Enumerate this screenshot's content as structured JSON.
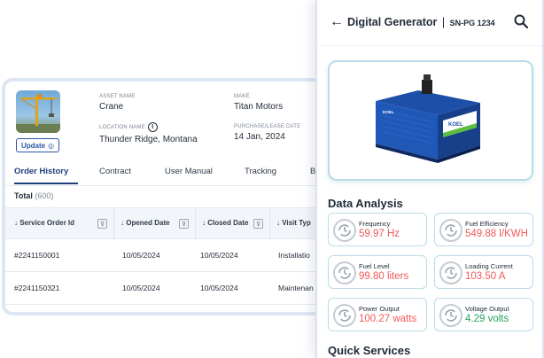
{
  "asset": {
    "name_label": "ASSET NAME",
    "name": "Crane",
    "make_label": "MAKE",
    "make": "Titan Motors",
    "location_label": "LOCATION NAME",
    "location": "Thunder Ridge, Montana",
    "purchase_label": "PURCHASE/LEASE DATE",
    "purchase_date": "14 Jan, 2024",
    "update_label": "Update"
  },
  "tabs": [
    "Order History",
    "Contract",
    "User Manual",
    "Tracking",
    "B"
  ],
  "total": {
    "label": "Total",
    "count": "(600)"
  },
  "table": {
    "columns": [
      "↓ Service Order Id",
      "↓ Opened Date",
      "↓ Closed Date",
      "↓ Visit Typ"
    ],
    "rows": [
      [
        "#2241150001",
        "10/05/2024",
        "10/05/2024",
        "Installatio"
      ],
      [
        "#2241150321",
        "10/05/2024",
        "10/05/2024",
        "Maintenan"
      ]
    ]
  },
  "device": {
    "title": "Digital Generator",
    "serial": "SN-PG 1234",
    "brand_on_image": "KOEL"
  },
  "data_analysis": {
    "title": "Data Analysis",
    "metrics": [
      {
        "label": "Frequency",
        "value": "59.97 Hz",
        "status": "red"
      },
      {
        "label": "Fuel Efficiency",
        "value": "549.88 l/KWH",
        "status": "red"
      },
      {
        "label": "Fuel Level",
        "value": "99.80 liters",
        "status": "red"
      },
      {
        "label": "Loading Current",
        "value": "103.50 A",
        "status": "red"
      },
      {
        "label": "Power Output",
        "value": "100.27 watts",
        "status": "red"
      },
      {
        "label": "Voltage Output",
        "value": "4.29 volts",
        "status": "green"
      }
    ]
  },
  "quick_services": {
    "title": "Quick Services"
  },
  "colors": {
    "accent": "#1d3f7a",
    "alert": "#f05a5a",
    "ok": "#25a35a",
    "card_border": "#b9dce6"
  }
}
